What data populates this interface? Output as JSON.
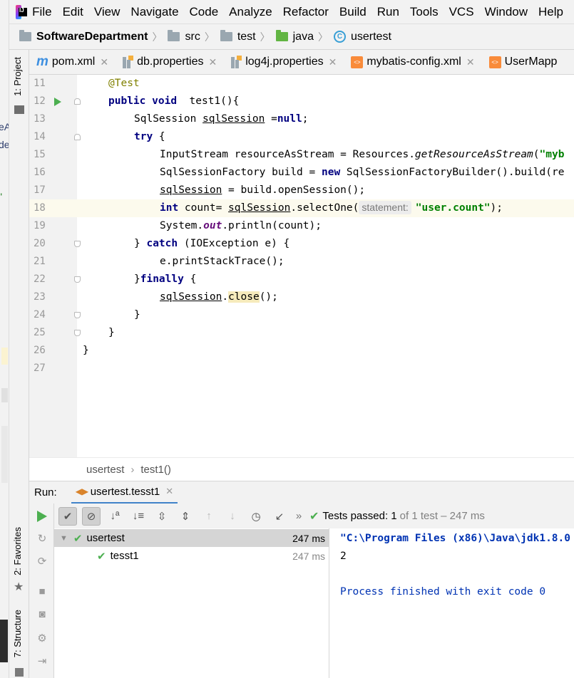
{
  "menu": {
    "items": [
      "File",
      "Edit",
      "View",
      "Navigate",
      "Code",
      "Analyze",
      "Refactor",
      "Build",
      "Run",
      "Tools",
      "VCS",
      "Window",
      "Help"
    ]
  },
  "navbar": {
    "project": "SoftwareDepartment",
    "crumbs": [
      "src",
      "test",
      "java",
      "usertest"
    ]
  },
  "side_tabs": {
    "project": "1: Project",
    "favorites": "2: Favorites",
    "structure": "7: Structure"
  },
  "tabs": [
    "pom.xml",
    "db.properties",
    "log4j.properties",
    "mybatis-config.xml",
    "UserMapp"
  ],
  "code_lines": [
    {
      "num": "11"
    },
    {
      "num": "12"
    },
    {
      "num": "13"
    },
    {
      "num": "14"
    },
    {
      "num": "15"
    },
    {
      "num": "16"
    },
    {
      "num": "17"
    },
    {
      "num": "18"
    },
    {
      "num": "19"
    },
    {
      "num": "20"
    },
    {
      "num": "21"
    },
    {
      "num": "22"
    },
    {
      "num": "23"
    },
    {
      "num": "24"
    },
    {
      "num": "25"
    },
    {
      "num": "26"
    },
    {
      "num": "27"
    }
  ],
  "code": {
    "l11_ann": "@Test",
    "l12_kw1": "public",
    "l12_kw2": "void",
    "l12_rest": "  test1(){",
    "l13_a": "SqlSession ",
    "l13_var": "sqlSession",
    "l13_b": " =",
    "l13_kw": "null",
    "l13_c": ";",
    "l14_kw": "try",
    "l14_rest": " {",
    "l15_a": "InputStream resourceAsStream = Resources.",
    "l15_method": "getResourceAsStream",
    "l15_b": "(",
    "l15_str": "\"myb",
    "l16_a": "SqlSessionFactory build = ",
    "l16_kw": "new",
    "l16_b": " SqlSessionFactoryBuilder().build(re",
    "l17_var": "sqlSession",
    "l17_rest": " = build.openSession();",
    "l18_kw": "int",
    "l18_a": " count= ",
    "l18_var": "sqlSession",
    "l18_b": ".selectOne(",
    "l18_hint": "statement:",
    "l18_str": "\"user.count\"",
    "l18_c": ");",
    "l19_a": "System.",
    "l19_field": "out",
    "l19_b": ".println(count);",
    "l20_a": "} ",
    "l20_kw": "catch",
    "l20_b": " (IOException e) {",
    "l21": "e.printStackTrace();",
    "l22_a": "}",
    "l22_kw": "finally",
    "l22_b": " {",
    "l23_var": "sqlSession",
    "l23_a": ".",
    "l23_method": "close",
    "l23_b": "();",
    "l24": "}",
    "l25": "}",
    "l26": "}"
  },
  "editor_crumb": [
    "usertest",
    "test1()"
  ],
  "run": {
    "label": "Run:",
    "tab": "usertest.tesst1",
    "status_prefix": "Tests passed:",
    "status_count": "1",
    "status_rest": "of 1 test – 247 ms",
    "tree": [
      {
        "name": "usertest",
        "time": "247 ms"
      },
      {
        "name": "tesst1",
        "time": "247 ms"
      }
    ],
    "console": [
      "\"C:\\Program Files (x86)\\Java\\jdk1.8.0",
      "2",
      "",
      "Process finished with exit code 0"
    ]
  },
  "colors": {
    "keyword": "#000080",
    "string": "#008000",
    "annotation": "#808000",
    "run_green": "#4caf50",
    "current_line": "#fcfaed"
  }
}
